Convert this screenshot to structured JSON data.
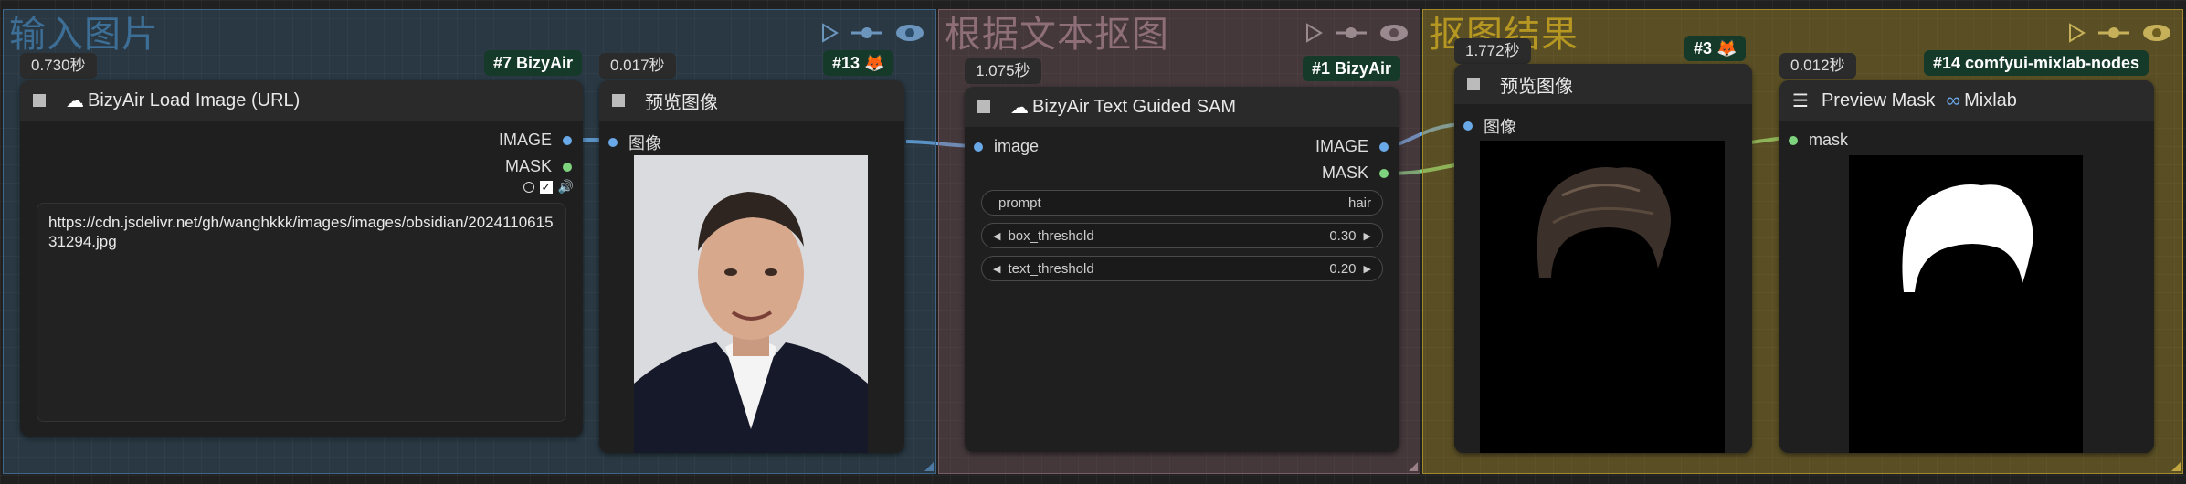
{
  "colors": {
    "group1": "#3d6688",
    "group2": "#7a5c65",
    "group3": "#a18a2b",
    "wire_image": "#6aa9e8",
    "wire_mask": "#7fd37f"
  },
  "groups": [
    {
      "title": "输入图片"
    },
    {
      "title": "根据文本抠图"
    },
    {
      "title": "抠图结果"
    }
  ],
  "group_tools": [
    "play-icon",
    "link-icon",
    "eye-icon"
  ],
  "nodes": {
    "load_image": {
      "time": "0.730秒",
      "badge": "#7 BizyAir",
      "title": "BizyAir Load Image (URL)",
      "outputs": [
        "IMAGE",
        "MASK"
      ],
      "url": "https://cdn.jsdelivr.net/gh/wanghkkk/images/images/obsidian/202411061531294.jpg"
    },
    "preview1": {
      "time": "0.017秒",
      "badge": "#13",
      "title": "预览图像",
      "input": "图像"
    },
    "sam": {
      "time": "1.075秒",
      "badge": "#1 BizyAir",
      "title": "BizyAir Text Guided SAM",
      "input": "image",
      "outputs": [
        "IMAGE",
        "MASK"
      ],
      "widgets": [
        {
          "label": "prompt",
          "value": "hair"
        },
        {
          "label": "box_threshold",
          "value": "0.30"
        },
        {
          "label": "text_threshold",
          "value": "0.20"
        }
      ]
    },
    "preview2": {
      "time": "1.772秒",
      "badge": "#3",
      "title": "预览图像",
      "input": "图像"
    },
    "preview_mask": {
      "time": "0.012秒",
      "badge": "#14 comfyui-mixlab-nodes",
      "title": "Preview Mask",
      "title_suffix": "Mixlab",
      "input": "mask"
    }
  }
}
